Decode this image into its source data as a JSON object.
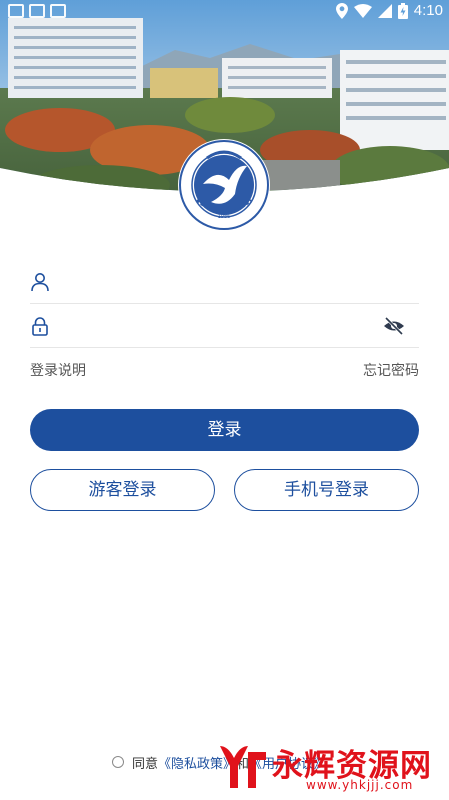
{
  "status_bar": {
    "time": "4:10"
  },
  "header": {
    "image": "campus-aerial-photo",
    "logo": "zhaotong-university-emblem",
    "logo_year": "1986"
  },
  "form": {
    "username": {
      "value": "",
      "placeholder": ""
    },
    "password": {
      "value": "",
      "placeholder": ""
    },
    "login_help_label": "登录说明",
    "forgot_password_label": "忘记密码"
  },
  "buttons": {
    "login_label": "登录",
    "guest_login_label": "游客登录",
    "phone_login_label": "手机号登录"
  },
  "agreement": {
    "prefix": "同意",
    "privacy_link": "《隐私政策》",
    "conjunction": "和",
    "terms_link": "《用户协议》"
  },
  "watermark": {
    "name": "永辉资源网",
    "url": "www.yhkjjj.com"
  },
  "colors": {
    "primary": "#1d4f9e",
    "watermark": "#e0121b"
  }
}
